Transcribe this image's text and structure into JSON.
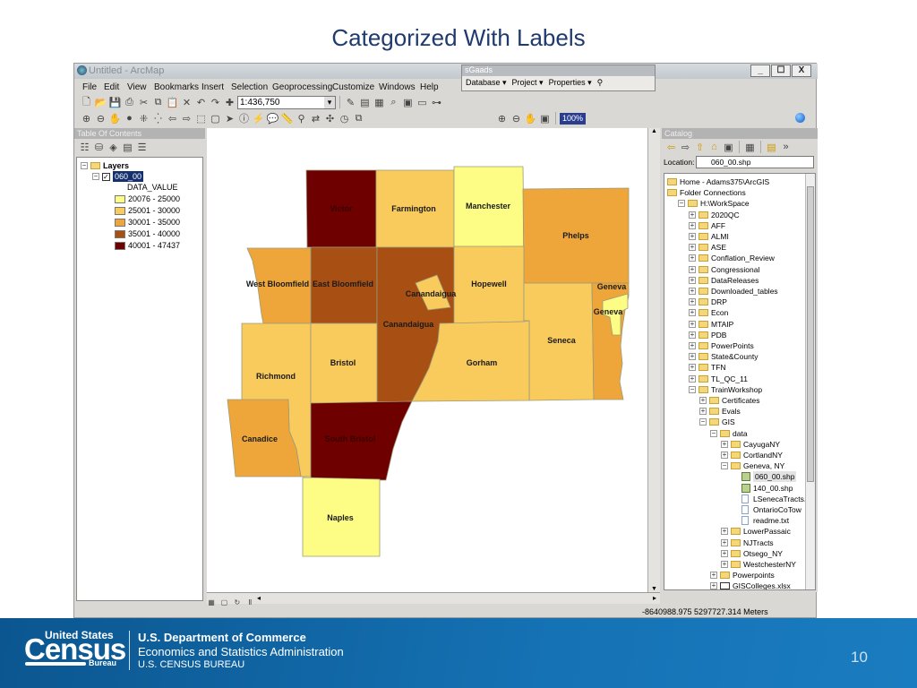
{
  "slide": {
    "title": "Categorized With Labels",
    "page_number": "10"
  },
  "window": {
    "title": "Untitled - ArcMap",
    "controls": [
      "_",
      "☐",
      "X"
    ]
  },
  "menu": [
    "File",
    "Edit",
    "View",
    "Bookmarks",
    "Insert",
    "Selection",
    "Geoprocessing",
    "Customize",
    "Windows",
    "Help"
  ],
  "toolbar1": {
    "icons": [
      "new-icon",
      "open-icon",
      "save-icon",
      "print-icon",
      "cut-icon",
      "copy-icon",
      "paste-icon",
      "delete-icon",
      "undo-icon",
      "redo-icon",
      "add-data-icon"
    ],
    "scale": "1:436,750",
    "icons2": [
      "editor-icon",
      "table-icon",
      "catalog-icon",
      "search-icon",
      "arctoolbox-icon",
      "python-icon",
      "model-icon"
    ]
  },
  "toolbar2": {
    "icons": [
      "zoom-in-icon",
      "zoom-out-icon",
      "pan-icon",
      "full-extent-icon",
      "fixed-zoom-in-icon",
      "fixed-zoom-out-icon",
      "back-icon",
      "forward-icon",
      "select-features-icon",
      "clear-selection-icon",
      "select-elements-icon",
      "identify-icon",
      "hyperlink-icon",
      "html-popup-icon",
      "measure-icon",
      "find-icon",
      "find-route-icon",
      "goto-xy-icon",
      "time-slider-icon",
      "create-viewer-icon"
    ]
  },
  "layout_toolbar": {
    "zoom": "100%"
  },
  "sgaads": {
    "title": "sGaads",
    "menus": [
      "Database ▾",
      "Project ▾",
      "Properties ▾"
    ]
  },
  "toc": {
    "title": "Table Of Contents",
    "root": "Layers",
    "layer": "060_00",
    "field": "DATA_VALUE",
    "legend": [
      {
        "label": "20076 - 25000",
        "color": "#fdfd86"
      },
      {
        "label": "25001 - 30000",
        "color": "#f8cb5c"
      },
      {
        "label": "30001 - 35000",
        "color": "#eea63a"
      },
      {
        "label": "35001 - 40000",
        "color": "#a84f14"
      },
      {
        "label": "40001 - 47437",
        "color": "#6e0000"
      }
    ]
  },
  "map": {
    "regions": [
      {
        "name": "Victor",
        "class": 4
      },
      {
        "name": "Farmington",
        "class": 1
      },
      {
        "name": "Manchester",
        "class": 0
      },
      {
        "name": "Phelps",
        "class": 2
      },
      {
        "name": "West Bloomfield",
        "class": 2
      },
      {
        "name": "East Bloomfield",
        "class": 3
      },
      {
        "name": "Canandaigua",
        "class": 3
      },
      {
        "name": "Hopewell",
        "class": 1
      },
      {
        "name": "Seneca",
        "class": 1
      },
      {
        "name": "Geneva",
        "class": 2
      },
      {
        "name": "Gorham",
        "class": 1
      },
      {
        "name": "Richmond",
        "class": 1
      },
      {
        "name": "Bristol",
        "class": 1
      },
      {
        "name": "Canadice",
        "class": 2
      },
      {
        "name": "South Bristol",
        "class": 4
      },
      {
        "name": "Naples",
        "class": 0
      },
      {
        "name": "Canandaigua",
        "class": 1
      },
      {
        "name": "Geneva",
        "class": 0
      }
    ]
  },
  "catalog": {
    "title": "Catalog",
    "location_label": "Location:",
    "location": "060_00.shp",
    "items": [
      {
        "l": 0,
        "e": "",
        "i": "home",
        "t": "Home - Adams375\\ArcGIS"
      },
      {
        "l": 0,
        "e": "",
        "i": "folder",
        "t": "Folder Connections"
      },
      {
        "l": 1,
        "e": "-",
        "i": "folder",
        "t": "H:\\WorkSpace"
      },
      {
        "l": 2,
        "e": "+",
        "i": "folder",
        "t": "2020QC"
      },
      {
        "l": 2,
        "e": "+",
        "i": "folder",
        "t": "AFF"
      },
      {
        "l": 2,
        "e": "+",
        "i": "folder",
        "t": "ALMI"
      },
      {
        "l": 2,
        "e": "+",
        "i": "folder",
        "t": "ASE"
      },
      {
        "l": 2,
        "e": "+",
        "i": "folder",
        "t": "Conflation_Review"
      },
      {
        "l": 2,
        "e": "+",
        "i": "folder",
        "t": "Congressional"
      },
      {
        "l": 2,
        "e": "+",
        "i": "folder",
        "t": "DataReleases"
      },
      {
        "l": 2,
        "e": "+",
        "i": "folder",
        "t": "Downloaded_tables"
      },
      {
        "l": 2,
        "e": "+",
        "i": "folder",
        "t": "DRP"
      },
      {
        "l": 2,
        "e": "+",
        "i": "folder",
        "t": "Econ"
      },
      {
        "l": 2,
        "e": "+",
        "i": "folder",
        "t": "MTAIP"
      },
      {
        "l": 2,
        "e": "+",
        "i": "folder",
        "t": "PDB"
      },
      {
        "l": 2,
        "e": "+",
        "i": "folder",
        "t": "PowerPoints"
      },
      {
        "l": 2,
        "e": "+",
        "i": "folder",
        "t": "State&County"
      },
      {
        "l": 2,
        "e": "+",
        "i": "folder",
        "t": "TFN"
      },
      {
        "l": 2,
        "e": "+",
        "i": "folder",
        "t": "TL_QC_11"
      },
      {
        "l": 2,
        "e": "-",
        "i": "folder",
        "t": "TrainWorkshop"
      },
      {
        "l": 3,
        "e": "+",
        "i": "folder",
        "t": "Certificates"
      },
      {
        "l": 3,
        "e": "+",
        "i": "folder",
        "t": "Evals"
      },
      {
        "l": 3,
        "e": "-",
        "i": "folder",
        "t": "GIS"
      },
      {
        "l": 4,
        "e": "-",
        "i": "folder",
        "t": "data"
      },
      {
        "l": 5,
        "e": "+",
        "i": "folder",
        "t": "CayugaNY"
      },
      {
        "l": 5,
        "e": "+",
        "i": "folder",
        "t": "CortlandNY"
      },
      {
        "l": 5,
        "e": "-",
        "i": "folder",
        "t": "Geneva, NY"
      },
      {
        "l": 6,
        "e": "",
        "i": "shp",
        "t": "060_00.shp",
        "sel": true
      },
      {
        "l": 6,
        "e": "",
        "i": "shp",
        "t": "140_00.shp"
      },
      {
        "l": 6,
        "e": "",
        "i": "file",
        "t": "LSenecaTracts."
      },
      {
        "l": 6,
        "e": "",
        "i": "file",
        "t": "OntarioCoTow"
      },
      {
        "l": 6,
        "e": "",
        "i": "file",
        "t": "readme.txt"
      },
      {
        "l": 5,
        "e": "+",
        "i": "folder",
        "t": "LowerPassaic"
      },
      {
        "l": 5,
        "e": "+",
        "i": "folder",
        "t": "NJTracts"
      },
      {
        "l": 5,
        "e": "+",
        "i": "folder",
        "t": "Otsego_NY"
      },
      {
        "l": 5,
        "e": "+",
        "i": "folder",
        "t": "WestchesterNY"
      },
      {
        "l": 4,
        "e": "+",
        "i": "folder",
        "t": "Powerpoints"
      },
      {
        "l": 4,
        "e": "+",
        "i": "xls",
        "t": "GISColleges.xlsx"
      }
    ]
  },
  "status": {
    "coordinates": "-8640988.975  5297727.314 Meters"
  },
  "footer": {
    "logo_top": "United States",
    "logo_main": "Census",
    "logo_bottom": "Bureau",
    "line1": "U.S. Department of Commerce",
    "line2": "Economics and Statistics Administration",
    "line3": "U.S. CENSUS BUREAU"
  }
}
